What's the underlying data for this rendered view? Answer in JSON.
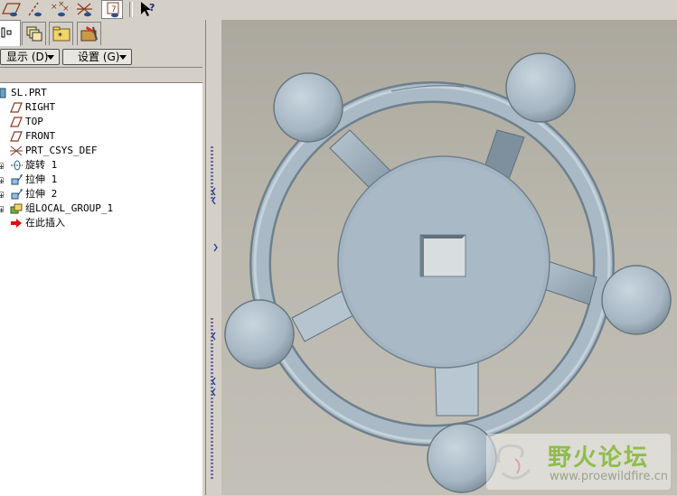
{
  "toolbar": {
    "icons": [
      "datum-plane-display-icon",
      "datum-axis-display-icon",
      "datum-point-display-icon",
      "csys-display-icon",
      "annotation-display-icon",
      "context-help-icon"
    ]
  },
  "panel": {
    "tabs": [
      "model-tree-tab",
      "layers-tab",
      "folder-browser-tab",
      "favorites-tab"
    ],
    "show_label": "显示 (D)",
    "settings_label": "设置 (G)"
  },
  "tree": {
    "items": [
      {
        "label": "SL.PRT",
        "icon": "part-icon"
      },
      {
        "label": "RIGHT",
        "icon": "datum-plane-icon"
      },
      {
        "label": "TOP",
        "icon": "datum-plane-icon"
      },
      {
        "label": "FRONT",
        "icon": "datum-plane-icon"
      },
      {
        "label": "PRT_CSYS_DEF",
        "icon": "csys-icon"
      },
      {
        "label": "旋转 1",
        "icon": "revolve-feature-icon"
      },
      {
        "label": "拉伸 1",
        "icon": "extrude-feature-icon"
      },
      {
        "label": "拉伸 2",
        "icon": "extrude-feature-icon"
      },
      {
        "label": "组LOCAL_GROUP_1",
        "icon": "group-icon"
      },
      {
        "label": "在此插入",
        "icon": "insert-here-arrow-icon"
      }
    ]
  },
  "watermark": {
    "title": "野火论坛",
    "url": "www.proewildfire.cn"
  },
  "colors": {
    "model_fill": "#a9bac6",
    "model_edge": "#5f6f7c",
    "background_top": "#aba89e",
    "background_bottom": "#c3c0b7",
    "insert_arrow": "#e01010"
  }
}
